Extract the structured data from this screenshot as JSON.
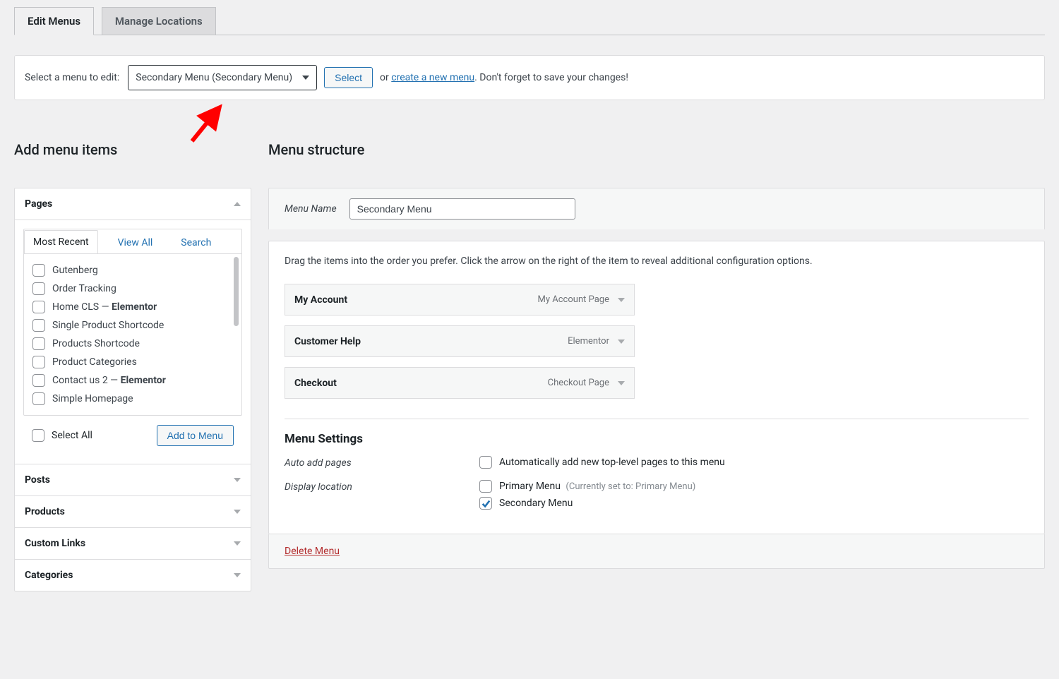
{
  "tabs": {
    "edit": "Edit Menus",
    "locations": "Manage Locations"
  },
  "selectBar": {
    "label": "Select a menu to edit:",
    "dropdown_value": "Secondary Menu (Secondary Menu)",
    "select_button": "Select",
    "or": "or",
    "create_link": "create a new menu",
    "trail": ". Don't forget to save your changes!"
  },
  "leftTitle": "Add menu items",
  "rightTitle": "Menu structure",
  "accordion": {
    "pages": {
      "label": "Pages",
      "innerTabs": {
        "recent": "Most Recent",
        "viewAll": "View All",
        "search": "Search"
      },
      "items": [
        {
          "label": "Gutenberg",
          "suffix": ""
        },
        {
          "label": "Order Tracking",
          "suffix": ""
        },
        {
          "label": "Home CLS — ",
          "suffix": "Elementor"
        },
        {
          "label": "Single Product Shortcode",
          "suffix": ""
        },
        {
          "label": "Products Shortcode",
          "suffix": ""
        },
        {
          "label": "Product Categories",
          "suffix": ""
        },
        {
          "label": "Contact us 2 — ",
          "suffix": "Elementor"
        },
        {
          "label": "Simple Homepage",
          "suffix": ""
        }
      ],
      "selectAll": "Select All",
      "addButton": "Add to Menu"
    },
    "posts": "Posts",
    "products": "Products",
    "custom": "Custom Links",
    "categories": "Categories"
  },
  "menuName": {
    "label": "Menu Name",
    "value": "Secondary Menu"
  },
  "instructions": "Drag the items into the order you prefer. Click the arrow on the right of the item to reveal additional configuration options.",
  "menuItems": [
    {
      "title": "My Account",
      "type": "My Account Page"
    },
    {
      "title": "Customer Help",
      "type": "Elementor"
    },
    {
      "title": "Checkout",
      "type": "Checkout Page"
    }
  ],
  "settings": {
    "title": "Menu Settings",
    "auto": {
      "label": "Auto add pages",
      "opt": "Automatically add new top-level pages to this menu"
    },
    "display": {
      "label": "Display location",
      "primary": "Primary Menu",
      "primaryNote": "(Currently set to: Primary Menu)",
      "secondary": "Secondary Menu"
    }
  },
  "deleteLink": "Delete Menu"
}
